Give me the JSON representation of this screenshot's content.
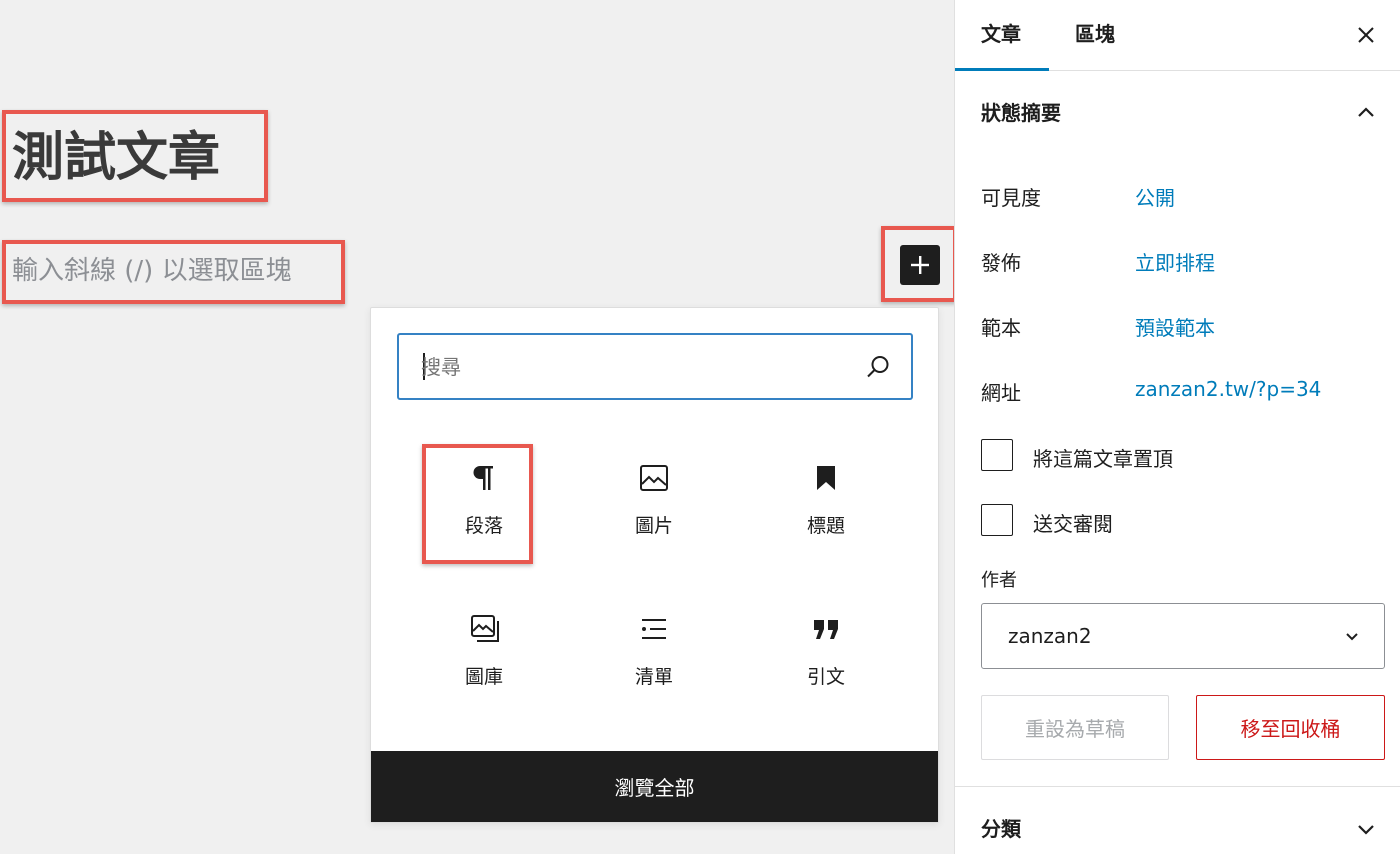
{
  "editor": {
    "title": "測試文章",
    "block_placeholder": "輸入斜線 (/) 以選取區塊",
    "add_block_icon": "plus-icon"
  },
  "inserter": {
    "search_placeholder": "搜尋",
    "search_icon": "search-icon",
    "blocks": [
      {
        "label": "段落",
        "icon": "paragraph-icon"
      },
      {
        "label": "圖片",
        "icon": "image-icon"
      },
      {
        "label": "標題",
        "icon": "bookmark-icon"
      },
      {
        "label": "圖庫",
        "icon": "gallery-icon"
      },
      {
        "label": "清單",
        "icon": "list-icon"
      },
      {
        "label": "引文",
        "icon": "quote-icon"
      }
    ],
    "browse_all": "瀏覽全部"
  },
  "sidebar": {
    "tabs": [
      {
        "label": "文章",
        "active": true
      },
      {
        "label": "區塊",
        "active": false
      }
    ],
    "close_icon": "close-icon",
    "status_panel": {
      "title": "狀態摘要",
      "rows": [
        {
          "label": "可見度",
          "value": "公開"
        },
        {
          "label": "發佈",
          "value": "立即排程"
        },
        {
          "label": "範本",
          "value": "預設範本"
        },
        {
          "label": "網址",
          "value": "zanzan2.tw/?p=34"
        }
      ],
      "checkboxes": [
        {
          "label": "將這篇文章置頂",
          "checked": false
        },
        {
          "label": "送交審閱",
          "checked": false
        }
      ],
      "author_label": "作者",
      "author_value": "zanzan2",
      "reset_draft": "重設為草稿",
      "move_trash": "移至回收桶"
    },
    "category_panel": {
      "title": "分類"
    }
  },
  "colors": {
    "highlight": "#e8584f",
    "accent": "#007cba",
    "danger": "#cc1818",
    "dark": "#1e1e1e"
  }
}
